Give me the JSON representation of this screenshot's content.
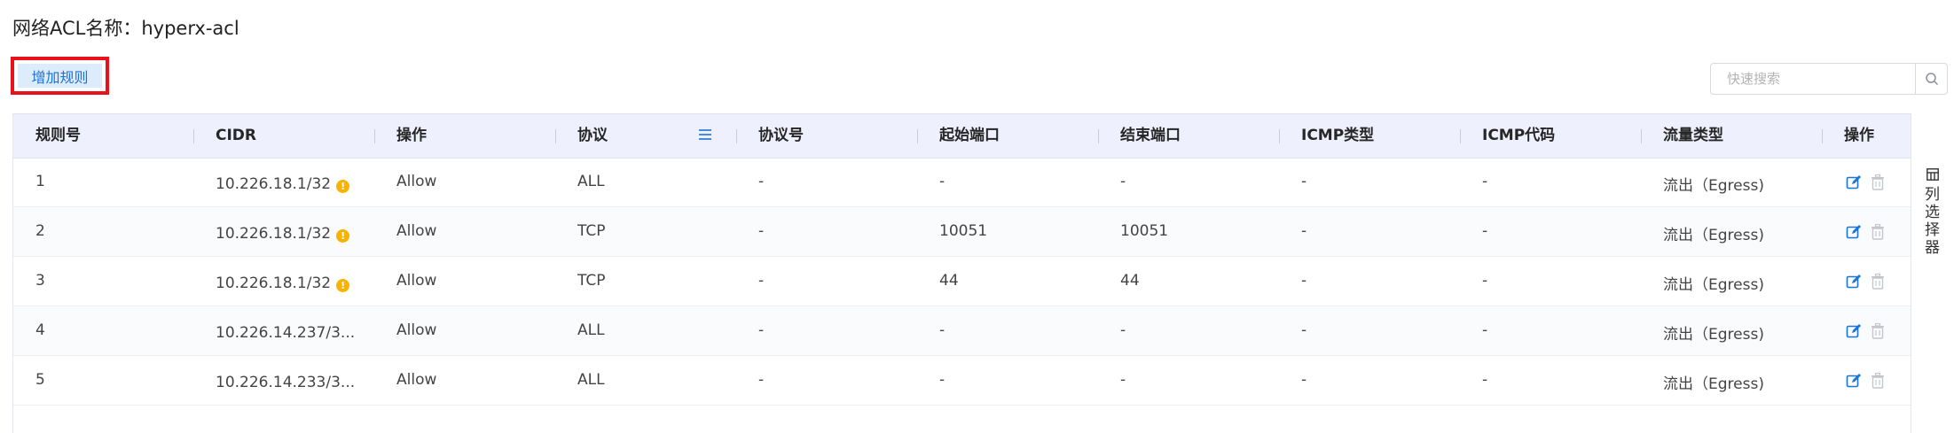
{
  "header": {
    "title_label": "网络ACL名称：",
    "title_value": "hyperx-acl",
    "add_rule_label": "增加规则",
    "search_placeholder": "快速搜索"
  },
  "table": {
    "columns": [
      "规则号",
      "CIDR",
      "操作",
      "协议",
      "协议号",
      "起始端口",
      "结束端口",
      "ICMP类型",
      "ICMP代码",
      "流量类型",
      "操作"
    ],
    "rows": [
      {
        "rule": "1",
        "cidr": "10.226.18.1/32",
        "warn": "!",
        "action": "Allow",
        "protocol": "ALL",
        "protocol_no": "-",
        "start_port": "-",
        "end_port": "-",
        "icmp_type": "-",
        "icmp_code": "-",
        "traffic": "流出（Egress)"
      },
      {
        "rule": "2",
        "cidr": "10.226.18.1/32",
        "warn": "!",
        "action": "Allow",
        "protocol": "TCP",
        "protocol_no": "-",
        "start_port": "10051",
        "end_port": "10051",
        "icmp_type": "-",
        "icmp_code": "-",
        "traffic": "流出（Egress)"
      },
      {
        "rule": "3",
        "cidr": "10.226.18.1/32",
        "warn": "!",
        "action": "Allow",
        "protocol": "TCP",
        "protocol_no": "-",
        "start_port": "44",
        "end_port": "44",
        "icmp_type": "-",
        "icmp_code": "-",
        "traffic": "流出（Egress)"
      },
      {
        "rule": "4",
        "cidr": "10.226.14.237/3...",
        "warn": "",
        "action": "Allow",
        "protocol": "ALL",
        "protocol_no": "-",
        "start_port": "-",
        "end_port": "-",
        "icmp_type": "-",
        "icmp_code": "-",
        "traffic": "流出（Egress)"
      },
      {
        "rule": "5",
        "cidr": "10.226.14.233/3...",
        "warn": "",
        "action": "Allow",
        "protocol": "ALL",
        "protocol_no": "-",
        "start_port": "-",
        "end_port": "-",
        "icmp_type": "-",
        "icmp_code": "-",
        "traffic": "流出（Egress)"
      }
    ]
  },
  "column_chooser": {
    "label": "列选择器",
    "icon": "columns-icon"
  },
  "colors": {
    "accent": "#1a73d9",
    "highlight_border": "#e8121d",
    "header_bg": "#eef1fd",
    "warning": "#f6b400"
  }
}
